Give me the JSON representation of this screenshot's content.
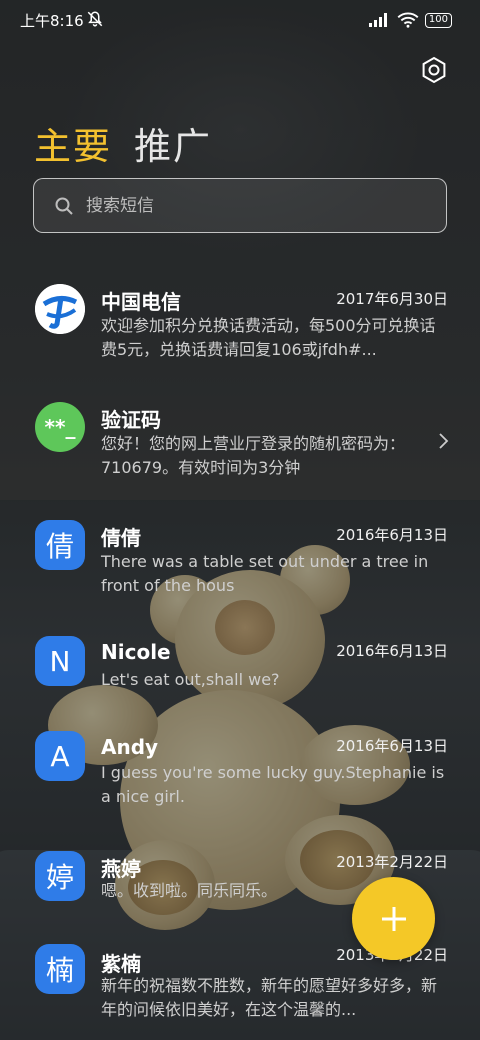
{
  "status_bar": {
    "time": "上午8:16",
    "mute_icon": "bell-off-icon",
    "signal_icon": "signal-bars-icon",
    "wifi_icon": "wifi-icon",
    "battery": "100"
  },
  "header": {
    "settings_icon": "hexagon-settings-icon",
    "tabs": [
      {
        "label": "主要",
        "active": true
      },
      {
        "label": "推广",
        "active": false
      }
    ]
  },
  "search": {
    "placeholder": "搜索短信",
    "value": ""
  },
  "conversations": [
    {
      "name": "中国电信",
      "date": "2017年6月30日",
      "preview": "欢迎参加积分兑换话费活动，每500分可兑换话费5元，兑换话费请回复106或jfdh#...",
      "avatar": "china-telecom-logo"
    },
    {
      "name": "验证码",
      "date": "",
      "preview": "您好！您的网上营业厅登录的随机密码为：710679。有效时间为3分钟",
      "avatar_text": "**_"
    },
    {
      "name": "倩倩",
      "date": "2016年6月13日",
      "preview": "There was a table set out under a tree in front of the hous",
      "avatar_text": "倩"
    },
    {
      "name": "Nicole",
      "date": "2016年6月13日",
      "preview": "Let's eat out,shall we?",
      "avatar_text": "N"
    },
    {
      "name": "Andy",
      "date": "2016年6月13日",
      "preview": "I guess you're some lucky guy.Stephanie is a nice girl.",
      "avatar_text": "A"
    },
    {
      "name": "燕婷",
      "date": "2013年2月22日",
      "preview": "嗯。收到啦。同乐同乐。",
      "avatar_text": "婷"
    },
    {
      "name": "紫楠",
      "date": "2013年2月22日",
      "preview": "新年的祝福数不胜数，新年的愿望好多好多，新年的问候依旧美好，在这个温馨的...",
      "avatar_text": "楠"
    }
  ],
  "fab": {
    "icon": "plus-icon"
  },
  "colors": {
    "accent": "#f3c12f",
    "avatar_blue": "#2f7ce8",
    "verify_green": "#5ec75a",
    "fab_yellow": "#f4c827"
  }
}
